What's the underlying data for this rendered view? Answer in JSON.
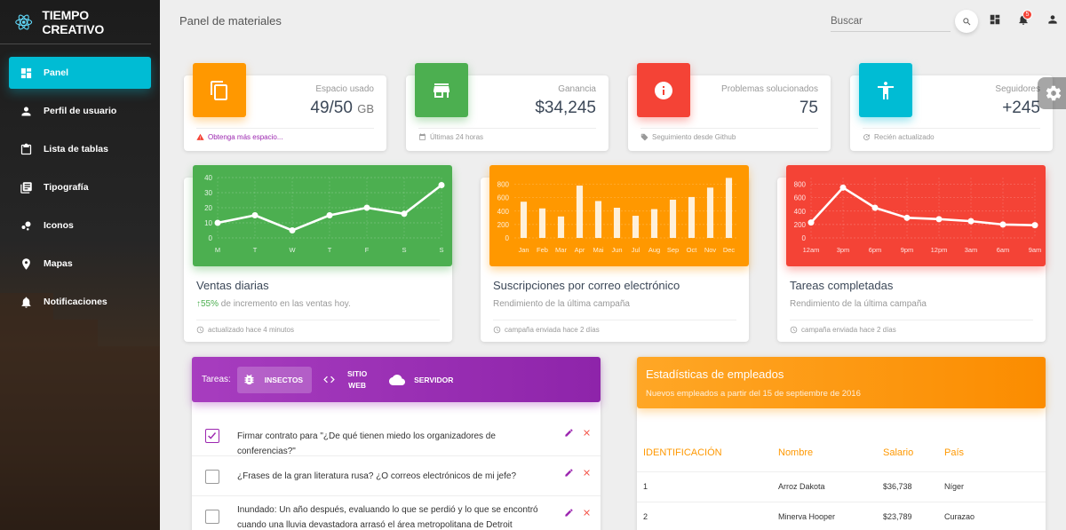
{
  "brand": {
    "name": "TIEMPO CREATIVO"
  },
  "sidebar": {
    "items": [
      {
        "label": "Panel",
        "icon": "dashboard-icon",
        "active": true
      },
      {
        "label": "Perfil de usuario",
        "icon": "person-icon"
      },
      {
        "label": "Lista de tablas",
        "icon": "clipboard-icon"
      },
      {
        "label": "Tipografía",
        "icon": "library-books-icon"
      },
      {
        "label": "Iconos",
        "icon": "bubble-chart-icon"
      },
      {
        "label": "Mapas",
        "icon": "location-pin-icon"
      },
      {
        "label": "Notificaciones",
        "icon": "notifications-icon"
      }
    ]
  },
  "topbar": {
    "title": "Panel de materiales",
    "search_placeholder": "Buscar",
    "notification_count": "5"
  },
  "stats": [
    {
      "category": "Espacio usado",
      "value": "49/50",
      "unit": "GB",
      "footer": "Obtenga más espacio...",
      "color": "#ff9800",
      "icon": "content-copy-icon",
      "footer_icon": "warning-icon"
    },
    {
      "category": "Ganancia",
      "value": "$34,245",
      "unit": "",
      "footer": "Últimas 24 horas",
      "color": "#4caf50",
      "icon": "store-icon",
      "footer_icon": "calendar-icon"
    },
    {
      "category": "Problemas solucionados",
      "value": "75",
      "unit": "",
      "footer": "Seguimiento desde Github",
      "color": "#f44336",
      "icon": "info-icon",
      "footer_icon": "tag-icon"
    },
    {
      "category": "Seguidores",
      "value": "+245",
      "unit": "",
      "footer": "Recién actualizado",
      "color": "#00bcd4",
      "icon": "accessibility-icon",
      "footer_icon": "update-icon"
    }
  ],
  "charts": [
    {
      "title": "Ventas diarias",
      "sub_highlight": "55%",
      "subtitle": " de incremento en las ventas hoy.",
      "footer": "actualizado hace 4 minutos",
      "color": "#4caf50"
    },
    {
      "title": "Suscripciones por correo electrónico",
      "subtitle": "Rendimiento de la última campaña",
      "footer": "campaña enviada hace 2 días",
      "color": "#ff9800"
    },
    {
      "title": "Tareas completadas",
      "subtitle": "Rendimiento de la última campaña",
      "footer": "campaña enviada hace 2 días",
      "color": "#f44336"
    }
  ],
  "chart_data": [
    {
      "type": "line",
      "categories": [
        "M",
        "T",
        "W",
        "T",
        "F",
        "S",
        "S"
      ],
      "values": [
        10,
        15,
        5,
        15,
        20,
        16,
        35
      ],
      "yticks": [
        "40",
        "30",
        "20",
        "10",
        "0"
      ],
      "ylim": [
        0,
        40
      ],
      "grid": true
    },
    {
      "type": "bar",
      "categories": [
        "Jan",
        "Feb",
        "Mar",
        "Apr",
        "Mai",
        "Jun",
        "Jul",
        "Aug",
        "Sep",
        "Oct",
        "Nov",
        "Dec"
      ],
      "values": [
        540,
        440,
        320,
        780,
        550,
        450,
        330,
        430,
        570,
        610,
        750,
        895
      ],
      "yticks": [
        "800",
        "600",
        "400",
        "200",
        "0"
      ],
      "ylim": [
        0,
        900
      ],
      "grid": true
    },
    {
      "type": "line",
      "categories": [
        "12am",
        "3pm",
        "6pm",
        "9pm",
        "12pm",
        "3am",
        "6am",
        "9am"
      ],
      "values": [
        230,
        750,
        450,
        300,
        280,
        250,
        200,
        190
      ],
      "yticks": [
        "800",
        "600",
        "400",
        "200",
        "0"
      ],
      "ylim": [
        0,
        900
      ],
      "grid": true
    }
  ],
  "tasks": {
    "label": "Tareas:",
    "tabs": [
      {
        "label": "INSECTOS",
        "icon": "bug-icon",
        "active": true
      },
      {
        "label": "SITIO WEB",
        "icon": "code-icon"
      },
      {
        "label": "SERVIDOR",
        "icon": "cloud-icon"
      }
    ],
    "items": [
      {
        "text": "Firmar contrato para \"¿De qué tienen miedo los organizadores de conferencias?\"",
        "checked": true
      },
      {
        "text": "¿Frases de la gran literatura rusa? ¿O correos electrónicos de mi jefe?",
        "checked": false
      },
      {
        "text": "Inundado: Un año después, evaluando lo que se perdió y lo que se encontró cuando una lluvia devastadora arrasó el área metropolitana de Detroit",
        "checked": false
      }
    ]
  },
  "employees": {
    "title": "Estadísticas de empleados",
    "subtitle": "Nuevos empleados a partir del 15 de septiembre de 2016",
    "columns": [
      "IDENTIFICACIÓN",
      "Nombre",
      "Salario",
      "País"
    ],
    "rows": [
      [
        "1",
        "Arroz Dakota",
        "$36,738",
        "Níger"
      ],
      [
        "2",
        "Minerva Hooper",
        "$23,789",
        "Curazao"
      ]
    ]
  }
}
